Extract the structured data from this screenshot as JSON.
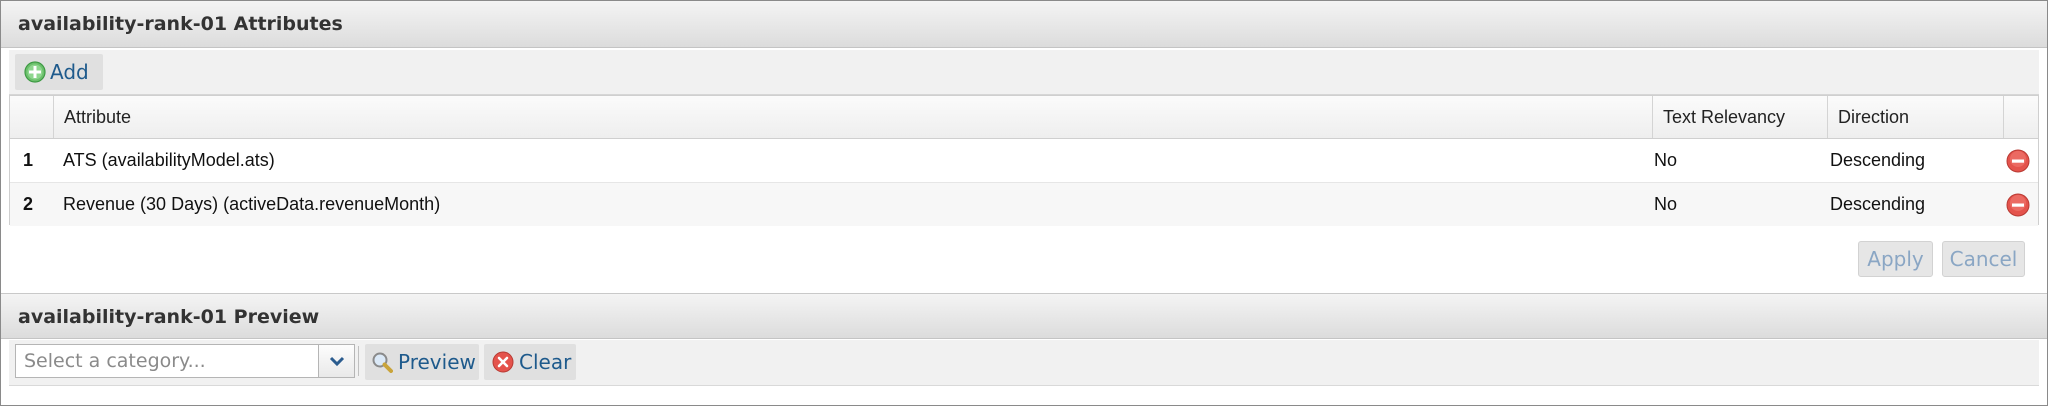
{
  "attributes_panel": {
    "title": "availability-rank-01 Attributes",
    "toolbar": {
      "add_label": "Add",
      "add_icon": "add-circle-icon"
    }
  },
  "grid": {
    "columns": [
      "Attribute",
      "Text Relevancy",
      "Direction"
    ],
    "rows": [
      {
        "num": "1",
        "attribute": "ATS (availabilityModel.ats)",
        "text_relevancy": "No",
        "direction": "Descending"
      },
      {
        "num": "2",
        "attribute": "Revenue (30 Days) (activeData.revenueMonth)",
        "text_relevancy": "No",
        "direction": "Descending"
      }
    ]
  },
  "actions": {
    "apply_label": "Apply",
    "cancel_label": "Cancel"
  },
  "preview_panel": {
    "title": "availability-rank-01 Preview",
    "category_placeholder": "Select a category...",
    "category_value": "",
    "preview_label": "Preview",
    "clear_label": "Clear"
  },
  "colors": {
    "link": "#1e5a8c",
    "add_green": "#4caf50",
    "delete_red": "#e0403a",
    "disabled_text": "#8aa6c4"
  }
}
